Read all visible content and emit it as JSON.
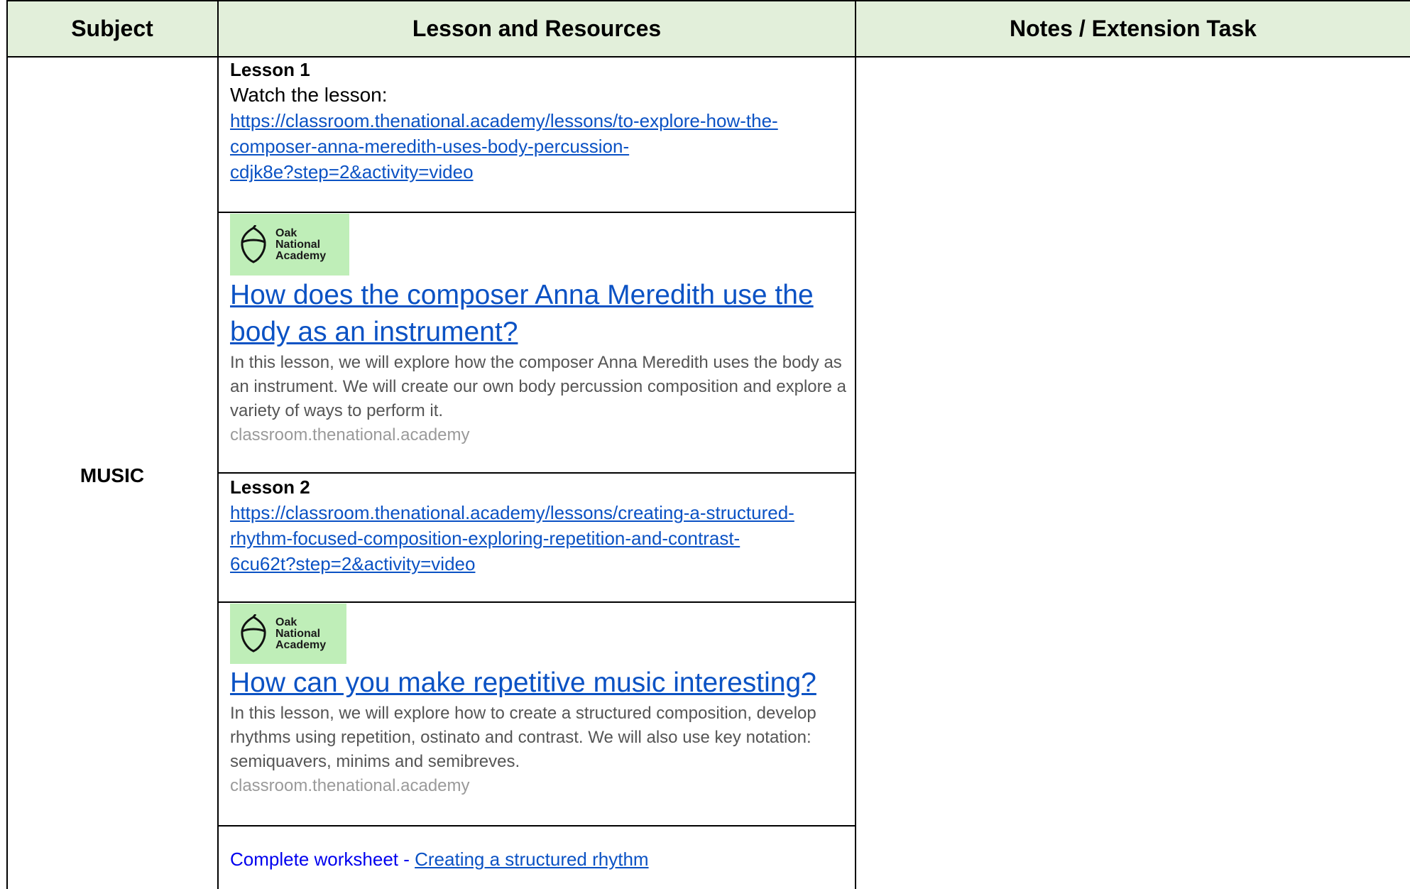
{
  "header": {
    "subject": "Subject",
    "lesson": "Lesson and Resources",
    "notes": "Notes / Extension Task"
  },
  "subject": "MUSIC",
  "lesson1": {
    "title": "Lesson 1",
    "instruction": "Watch the lesson:",
    "url": "https://classroom.thenational.academy/lessons/to-explore-how-the-composer-anna-meredith-uses-body-percussion-cdjk8e?step=2&activity=video",
    "url_lines": [
      "https://classroom.thenational.academy/lessons/to-explore-how-the-",
      "composer-anna-meredith-uses-body-percussion-",
      "cdjk8e?step=2&activity=video"
    ]
  },
  "card1": {
    "logo": {
      "line1": "Oak",
      "line2": "National",
      "line3": "Academy",
      "icon": "acorn-icon",
      "bg": "#bfeeb8"
    },
    "title": "How does the composer Anna Meredith use the body as an instrument?",
    "description": "In this lesson, we will explore how the composer Anna Meredith uses the body as an instrument. We will create our own body percussion composition and explore a variety of ways to perform it.",
    "domain": "classroom.thenational.academy"
  },
  "lesson2": {
    "title": "Lesson 2",
    "url": "https://classroom.thenational.academy/lessons/creating-a-structured-rhythm-focused-composition-exploring-repetition-and-contrast-6cu62t?step=2&activity=video",
    "url_lines": [
      "https://classroom.thenational.academy/lessons/creating-a-structured-",
      "rhythm-focused-composition-exploring-repetition-and-contrast-",
      "6cu62t?step=2&activity=video"
    ]
  },
  "card2": {
    "logo": {
      "line1": "Oak",
      "line2": "National",
      "line3": "Academy",
      "icon": "acorn-icon",
      "bg": "#bfeeb8"
    },
    "title": "How can you make repetitive music interesting?",
    "description": "In this lesson, we will explore how to create a structured composition, develop rhythms using repetition, ostinato and contrast. We will also use key notation: semiquavers, minims and semibreves.",
    "domain": "classroom.thenational.academy"
  },
  "worksheet": {
    "prefix": "Complete worksheet - ",
    "link": "Creating a structured rhythm"
  },
  "colors": {
    "header_bg": "#e2efda",
    "link": "#0b52c4",
    "worksheet_text": "#0000ee",
    "logo_bg": "#bfeeb8"
  }
}
